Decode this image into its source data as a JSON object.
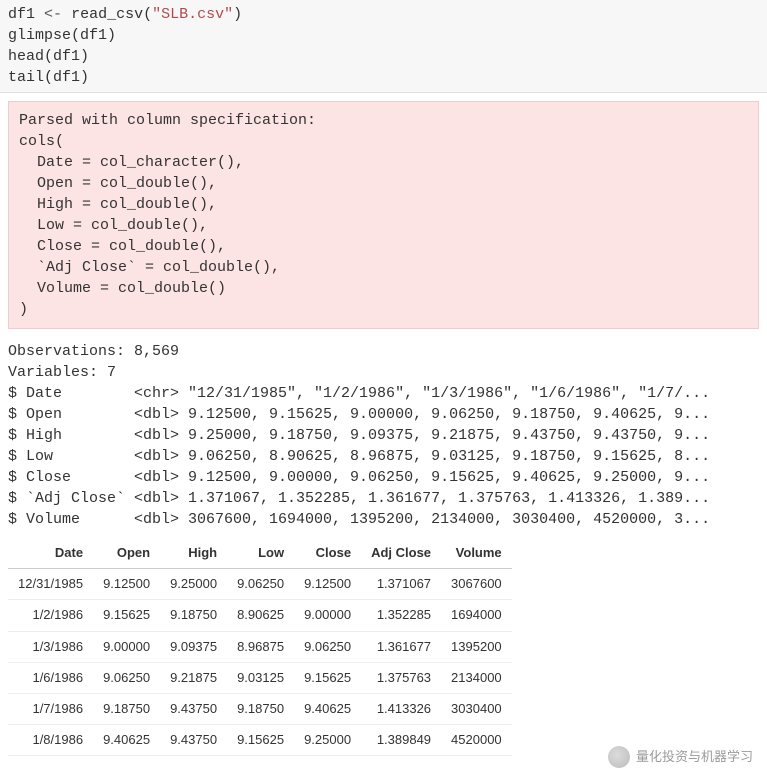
{
  "code": {
    "var": "df1",
    "assign": "<-",
    "fn_read": "read_csv",
    "str_open": "\"",
    "filename": "SLB.csv",
    "str_close": "\"",
    "line2": "glimpse(df1)",
    "line3": "head(df1)",
    "line4": "tail(df1)"
  },
  "msg": {
    "l1": "Parsed with column specification:",
    "l2": "cols(",
    "l3": "  Date = col_character(),",
    "l4": "  Open = col_double(),",
    "l5": "  High = col_double(),",
    "l6": "  Low = col_double(),",
    "l7": "  Close = col_double(),",
    "l8": "  `Adj Close` = col_double(),",
    "l9": "  Volume = col_double()",
    "l10": ")"
  },
  "glimpse": {
    "obs": "Observations: 8,569",
    "vars": "Variables: 7",
    "r1": "$ Date        <chr> \"12/31/1985\", \"1/2/1986\", \"1/3/1986\", \"1/6/1986\", \"1/7/...",
    "r2": "$ Open        <dbl> 9.12500, 9.15625, 9.00000, 9.06250, 9.18750, 9.40625, 9...",
    "r3": "$ High        <dbl> 9.25000, 9.18750, 9.09375, 9.21875, 9.43750, 9.43750, 9...",
    "r4": "$ Low         <dbl> 9.06250, 8.90625, 8.96875, 9.03125, 9.18750, 9.15625, 8...",
    "r5": "$ Close       <dbl> 9.12500, 9.00000, 9.06250, 9.15625, 9.40625, 9.25000, 9...",
    "r6": "$ `Adj Close` <dbl> 1.371067, 1.352285, 1.361677, 1.375763, 1.413326, 1.389...",
    "r7": "$ Volume      <dbl> 3067600, 1694000, 1395200, 2134000, 3030400, 4520000, 3..."
  },
  "table": {
    "headers": [
      "Date",
      "Open",
      "High",
      "Low",
      "Close",
      "Adj Close",
      "Volume"
    ],
    "rows": [
      [
        "12/31/1985",
        "9.12500",
        "9.25000",
        "9.06250",
        "9.12500",
        "1.371067",
        "3067600"
      ],
      [
        "1/2/1986",
        "9.15625",
        "9.18750",
        "8.90625",
        "9.00000",
        "1.352285",
        "1694000"
      ],
      [
        "1/3/1986",
        "9.00000",
        "9.09375",
        "8.96875",
        "9.06250",
        "1.361677",
        "1395200"
      ],
      [
        "1/6/1986",
        "9.06250",
        "9.21875",
        "9.03125",
        "9.15625",
        "1.375763",
        "2134000"
      ],
      [
        "1/7/1986",
        "9.18750",
        "9.43750",
        "9.18750",
        "9.40625",
        "1.413326",
        "3030400"
      ],
      [
        "1/8/1986",
        "9.40625",
        "9.43750",
        "9.15625",
        "9.25000",
        "1.389849",
        "4520000"
      ]
    ]
  },
  "watermark": "量化投资与机器学习"
}
